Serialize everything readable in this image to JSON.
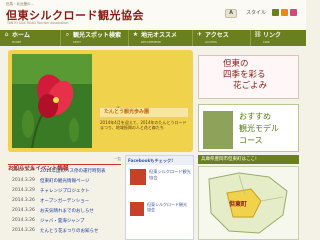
{
  "header": {
    "tagline": "但馬・北近畿の…",
    "title": "但東シルクロード観光協会",
    "subtitle": "TANTO SILK ROAD Tourism Association",
    "text_size_label": "A",
    "style_label": "スタイル"
  },
  "nav": [
    {
      "label": "ホーム",
      "sub": "HOME",
      "icon": "home-icon"
    },
    {
      "label": "観光スポット検索",
      "sub": "SPOT",
      "icon": "search-icon"
    },
    {
      "label": "地元オススメ",
      "sub": "RECOMMEND",
      "icon": "star-icon"
    },
    {
      "label": "アクセス",
      "sub": "ACCESS",
      "icon": "car-icon"
    },
    {
      "label": "リンク",
      "sub": "LINK",
      "icon": "link-icon"
    }
  ],
  "hero": {
    "label": "たんとう観光歩み園",
    "text": "2014年4月を迎えて、2014年のたんとうロードまつり、地域振興の人と花と森たち"
  },
  "banners": {
    "seasonal_title_1": "但東の",
    "seasonal_title_2": "四季を彩る",
    "seasonal_title_3": "花ごよみ",
    "model_course_1": "おすすめ",
    "model_course_2": "観光モデル",
    "model_course_3": "コース"
  },
  "news": {
    "heading": "お知らせ＆イベント情報",
    "more": "一覧",
    "items": [
      {
        "date": "2014.3.29",
        "title": "2014年度のバス停の運行時刻表"
      },
      {
        "date": "2014.3.29",
        "title": "但東町の観光情報ページ"
      },
      {
        "date": "2014.3.29",
        "title": "チャレンジプロジェクト"
      },
      {
        "date": "2014.3.26",
        "title": "オープンガーデンショー"
      },
      {
        "date": "2014.3.26",
        "title": "お天気晴れまでのおしらせ"
      },
      {
        "date": "2014.3.26",
        "title": "ジャバ・雲海ジャンプ"
      },
      {
        "date": "2014.3.26",
        "title": "たんとう花まつりのお知らせ"
      }
    ]
  },
  "facebook": {
    "heading": "Facebookもチェック!",
    "page_name": "但東シルクロード観光協会",
    "post_name": "但東シルクロード観光協会"
  },
  "sidebar": {
    "heading": "兵庫県豊岡市但東町はここ!",
    "map_label": "但東町"
  },
  "colors": {
    "nav_green": "#6a7f1e",
    "title_red": "#8a1a10",
    "hero_yellow": "#f1d24c"
  }
}
